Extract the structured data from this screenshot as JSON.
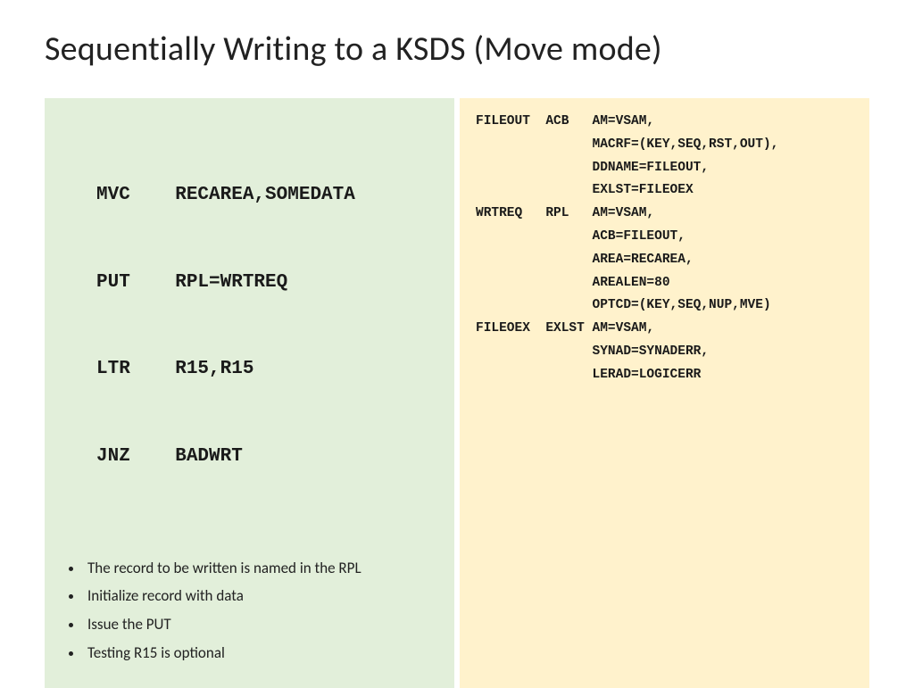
{
  "title": "Sequentially Writing to a KSDS (Move mode)",
  "asm": {
    "l1": "MVC    RECAREA,SOMEDATA",
    "l2": "PUT    RPL=WRTREQ",
    "l3": "LTR    R15,R15",
    "l4": "JNZ    BADWRT"
  },
  "bullets": {
    "b1": "The record to be written is named in the RPL",
    "b2": "Initialize record with data",
    "b3": "Issue the PUT",
    "b4": "Testing R15 is optional"
  },
  "right": {
    "r01": "FILEOUT  ACB   AM=VSAM,",
    "r02": "               MACRF=(KEY,SEQ,RST,OUT),",
    "r03": "               DDNAME=FILEOUT,",
    "r04": "               EXLST=FILEOEX",
    "r05": "WRTREQ   RPL   AM=VSAM,",
    "r06": "               ACB=FILEOUT,",
    "r07": "               AREA=RECAREA,",
    "r08": "               AREALEN=80",
    "r09": "               OPTCD=(KEY,SEQ,NUP,MVE)",
    "r10": "FILEOEX  EXLST AM=VSAM,",
    "r11": "               SYNAD=SYNADERR,",
    "r12": "               LERAD=LOGICERR"
  }
}
